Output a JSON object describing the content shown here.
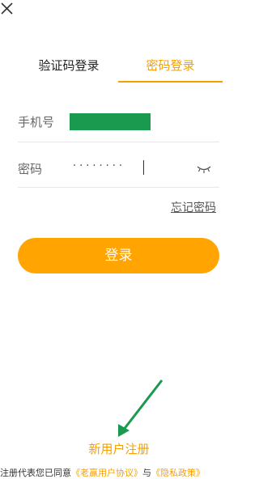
{
  "header": {
    "close_icon": "close-icon"
  },
  "tabs": [
    {
      "label": "验证码登录",
      "active": false
    },
    {
      "label": "密码登录",
      "active": true
    }
  ],
  "form": {
    "phone_label": "手机号",
    "password_label": "密码",
    "password_mask": "········",
    "eye_icon": "eye-closed-icon"
  },
  "forgot_label": "忘记密码",
  "login_label": "登录",
  "register_label": "新用户注册",
  "agreement": {
    "prefix": "注册代表您已同意",
    "link1": "《老赢用户协议》",
    "middle": "与",
    "link2": "《隐私政策》"
  },
  "colors": {
    "accent": "#f5a000",
    "button": "#ffa400",
    "phone_value_block": "#1a9a4f",
    "arrow": "#1a9a4f"
  }
}
